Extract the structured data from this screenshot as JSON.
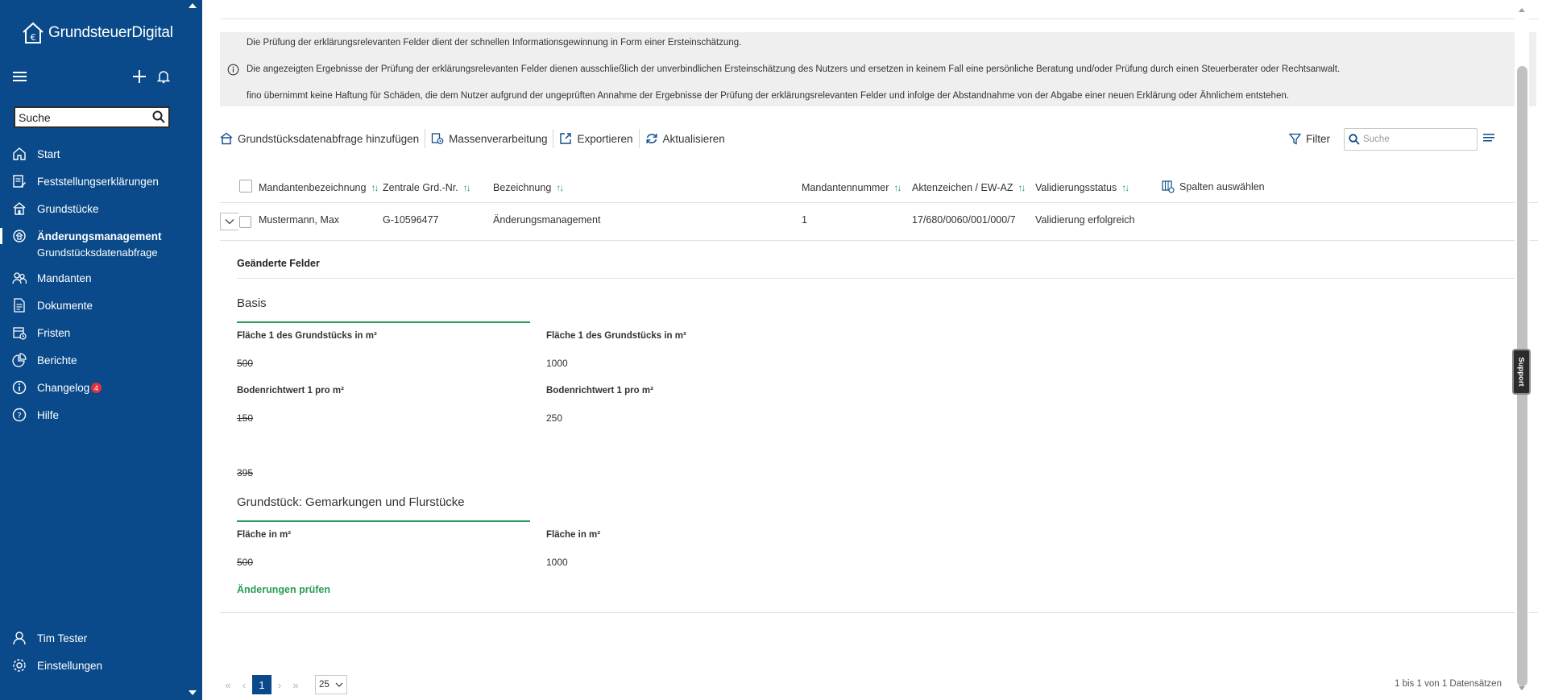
{
  "sidebar": {
    "logo_text": "GrundsteuerDigital",
    "search_placeholder": "Suche",
    "nav": [
      {
        "label": "Start",
        "icon": "home-icon"
      },
      {
        "label": "Feststellungserklärungen",
        "icon": "document-edit-icon"
      },
      {
        "label": "Grundstücke",
        "icon": "house-icon"
      },
      {
        "label": "Änderungsmanagement",
        "icon": "change-management-icon",
        "active": true
      },
      {
        "label": "Mandanten",
        "icon": "users-icon"
      },
      {
        "label": "Dokumente",
        "icon": "file-icon"
      },
      {
        "label": "Fristen",
        "icon": "calendar-icon"
      },
      {
        "label": "Berichte",
        "icon": "pie-chart-icon"
      },
      {
        "label": "Changelog",
        "icon": "info-icon",
        "badge": "4"
      },
      {
        "label": "Hilfe",
        "icon": "help-icon"
      }
    ],
    "sub_item": "Grundstücksdatenabfrage",
    "bottom": [
      {
        "label": "Tim Tester",
        "icon": "user-icon"
      },
      {
        "label": "Einstellungen",
        "icon": "gear-icon"
      }
    ]
  },
  "info": {
    "line1": "Die Prüfung der erklärungsrelevanten Felder dient der schnellen Informationsgewinnung in Form einer Ersteinschätzung.",
    "line2": "Die angezeigten Ergebnisse der Prüfung der erklärungsrelevanten Felder dienen ausschließlich der unverbindlichen Ersteinschätzung des Nutzers und ersetzen in keinem Fall eine persönliche Beratung und/oder Prüfung durch einen Steuerberater oder Rechtsanwalt.",
    "line3": "fino übernimmt keine Haftung für Schäden, die dem Nutzer aufgrund der ungeprüften Annahme der Ergebnisse der Prüfung der erklärungsrelevanten Felder und infolge der Abstandnahme von der Abgabe einer neuen Erklärung oder Ähnlichem entstehen."
  },
  "toolbar": {
    "add": "Grundstücksdatenabfrage hinzufügen",
    "mass": "Massenverarbeitung",
    "export": "Exportieren",
    "refresh": "Aktualisieren",
    "filter": "Filter",
    "search_placeholder": "Suche"
  },
  "table": {
    "columns": [
      "Mandantenbezeichnung",
      "Zentrale Grd.-Nr.",
      "Bezeichnung",
      "Mandantennummer",
      "Aktenzeichen / EW-AZ",
      "Validierungsstatus"
    ],
    "select_columns": "Spalten auswählen",
    "row": {
      "mandant": "Mustermann, Max",
      "grd_nr": "G-10596477",
      "bezeichnung": "Änderungsmanagement",
      "nummer": "1",
      "aktenzeichen": "17/680/0060/001/000/7",
      "status": "Validierung erfolgreich"
    }
  },
  "detail": {
    "title": "Geänderte Felder",
    "basis": {
      "title": "Basis",
      "f1_label": "Fläche 1 des Grundstücks in m²",
      "f1_old": "500",
      "f1_new": "1000",
      "f2_label": "Bodenrichtwert 1 pro m²",
      "f2_old": "150",
      "f2_new": "250",
      "f3_old": "395"
    },
    "grundstueck": {
      "title": "Grundstück: Gemarkungen und Flurstücke",
      "f1_label": "Fläche in m²",
      "f1_old": "500",
      "f1_new": "1000"
    },
    "check_link": "Änderungen prüfen"
  },
  "pager": {
    "first": "«",
    "prev": "‹",
    "current": "1",
    "next": "›",
    "last": "»",
    "per_page": "25",
    "count": "1 bis 1 von 1 Datensätzen"
  },
  "support": "Support",
  "colors": {
    "sidebar": "#0a4a8a",
    "accent_green": "#2a9d55",
    "badge_red": "#e0323c"
  }
}
